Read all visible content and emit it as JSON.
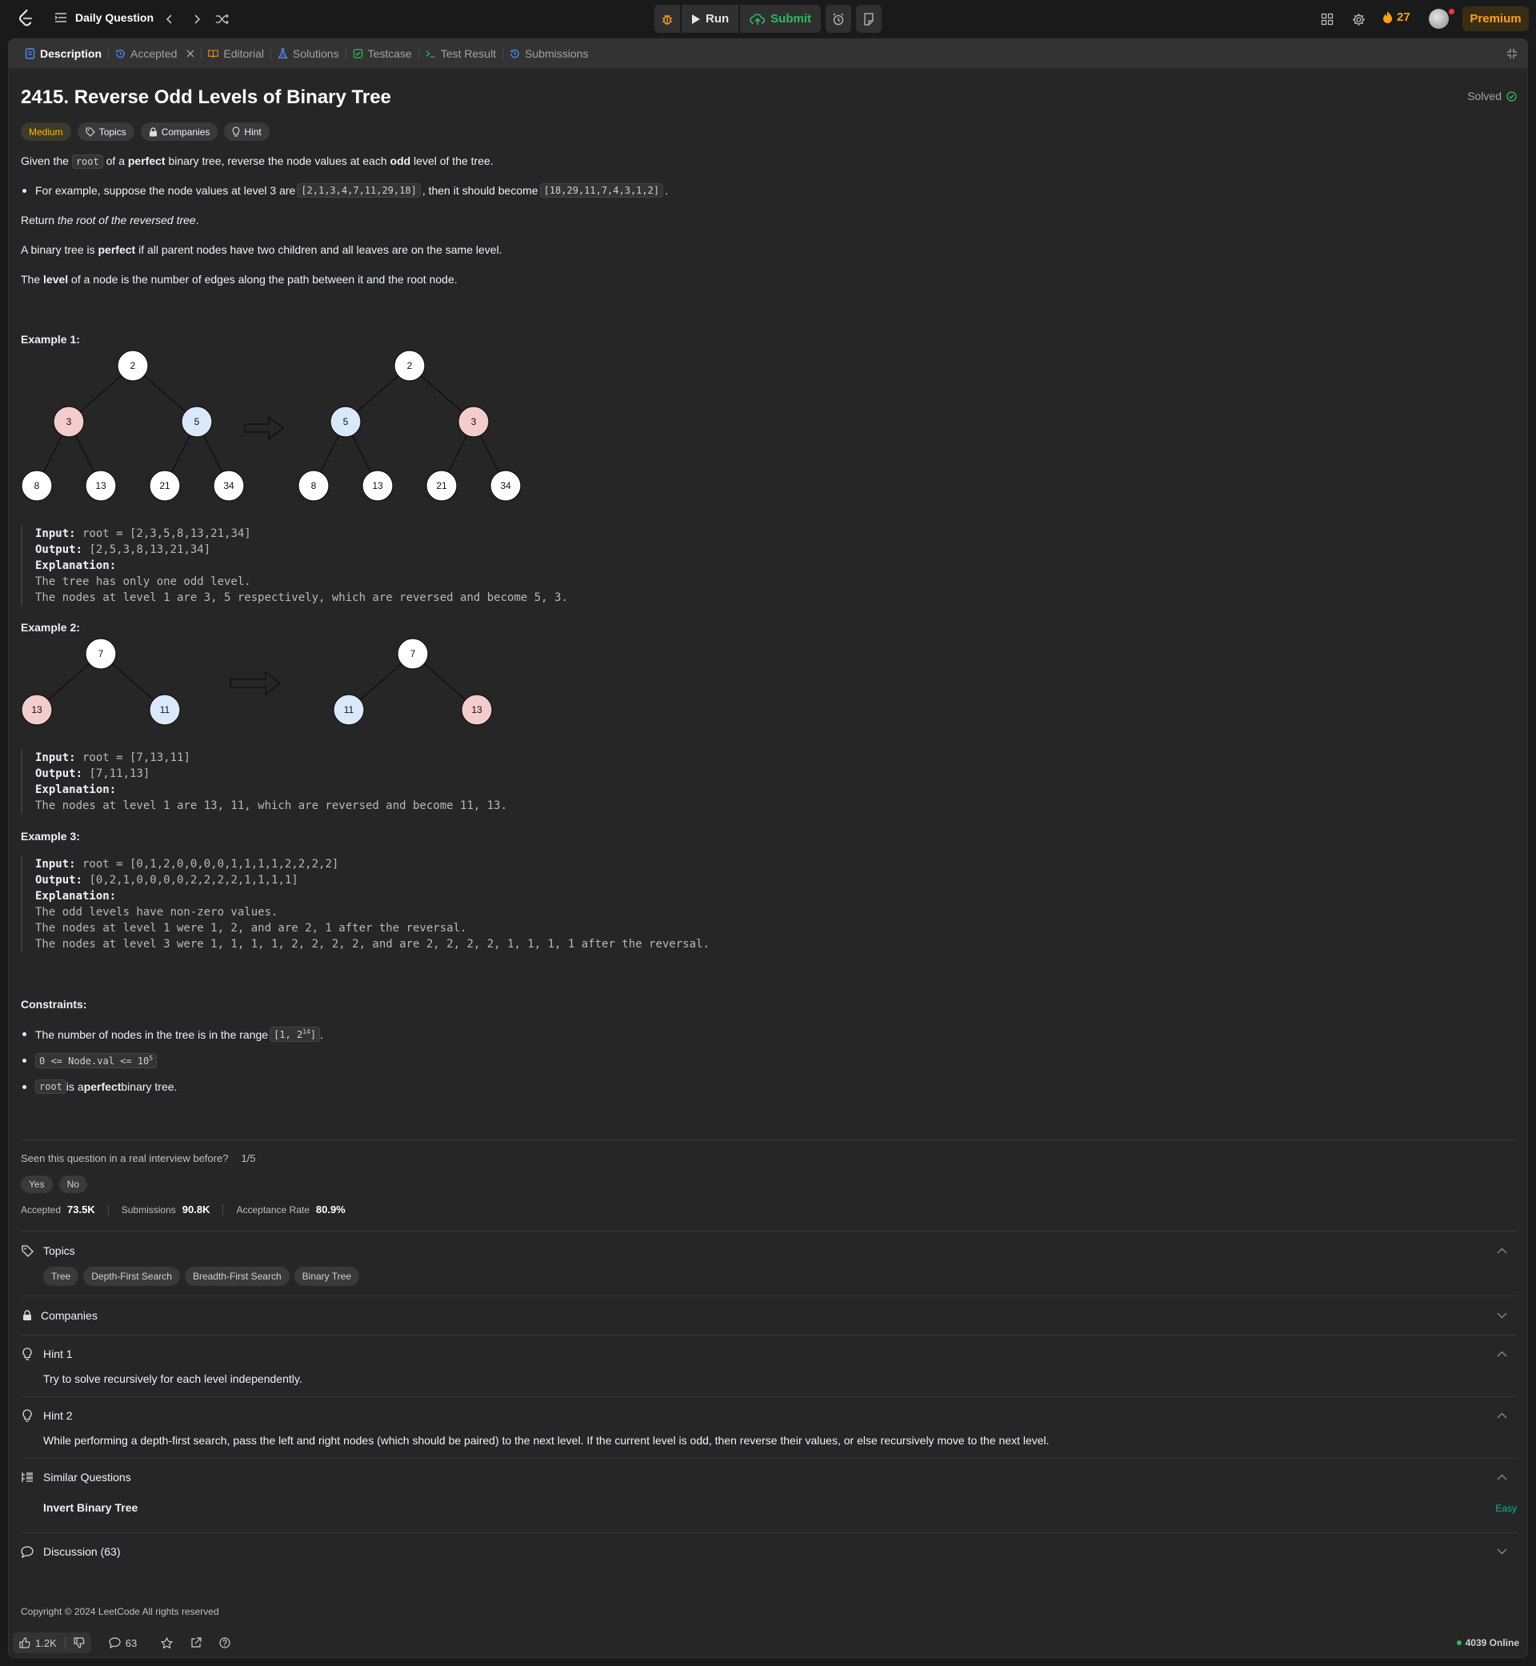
{
  "header": {
    "title": "Daily Question",
    "run_label": "Run",
    "submit_label": "Submit",
    "streak": "27",
    "premium_label": "Premium"
  },
  "tabs": [
    {
      "label": "Description"
    },
    {
      "label": "Accepted"
    },
    {
      "label": "Editorial"
    },
    {
      "label": "Solutions"
    },
    {
      "label": "Testcase"
    },
    {
      "label": "Test Result"
    },
    {
      "label": "Submissions"
    }
  ],
  "problem": {
    "title": "2415. Reverse Odd Levels of Binary Tree",
    "solved_label": "Solved",
    "chips": {
      "difficulty": "Medium",
      "topics": "Topics",
      "companies": "Companies",
      "hint": "Hint"
    },
    "desc": {
      "p1a": "Given the ",
      "p1code": "root",
      "p1b": " of a ",
      "p1bold": "perfect",
      "p1c": " binary tree, reverse the node values at each ",
      "p1bold2": "odd",
      "p1d": " level of the tree.",
      "b1a": "For example, suppose the node values at level 3 are ",
      "b1code": "[2,1,3,4,7,11,29,18]",
      "b1b": ", then it should become ",
      "b1code2": "[18,29,11,7,4,3,1,2]",
      "b1c": ".",
      "p2a": "Return ",
      "p2i": "the root of the reversed tree",
      "p2b": ".",
      "p3a": "A binary tree is ",
      "p3bold": "perfect",
      "p3b": " if all parent nodes have two children and all leaves are on the same level.",
      "p4a": "The ",
      "p4bold": "level",
      "p4b": " of a node is the number of edges along the path between it and the root node."
    },
    "example1": {
      "title": "Example 1:",
      "left": {
        "root": "2",
        "l1": [
          "3",
          "5"
        ],
        "l2": [
          "8",
          "13",
          "21",
          "34"
        ]
      },
      "right": {
        "root": "2",
        "l1": [
          "5",
          "3"
        ],
        "l2": [
          "8",
          "13",
          "21",
          "34"
        ]
      },
      "input_label": "Input:",
      "input": " root = [2,3,5,8,13,21,34]",
      "output_label": "Output:",
      "output": " [2,5,3,8,13,21,34]",
      "explanation_label": "Explanation:",
      "explanation": [
        "The tree has only one odd level.",
        "The nodes at level 1 are 3, 5 respectively, which are reversed and become 5, 3."
      ]
    },
    "example2": {
      "title": "Example 2:",
      "left": {
        "root": "7",
        "l1": [
          "13",
          "11"
        ]
      },
      "right": {
        "root": "7",
        "l1": [
          "11",
          "13"
        ]
      },
      "input_label": "Input:",
      "input": " root = [7,13,11]",
      "output_label": "Output:",
      "output": " [7,11,13]",
      "explanation_label": "Explanation:",
      "explanation": [
        "The nodes at level 1 are 13, 11, which are reversed and become 11, 13."
      ]
    },
    "example3": {
      "title": "Example 3:",
      "input_label": "Input:",
      "input": " root = [0,1,2,0,0,0,0,1,1,1,1,2,2,2,2]",
      "output_label": "Output:",
      "output": " [0,2,1,0,0,0,0,2,2,2,2,1,1,1,1]",
      "explanation_label": "Explanation:",
      "explanation": [
        "The odd levels have non-zero values.",
        "The nodes at level 1 were 1, 2, and are 2, 1 after the reversal.",
        "The nodes at level 3 were 1, 1, 1, 1, 2, 2, 2, 2, and are 2, 2, 2, 2, 1, 1, 1, 1 after the reversal."
      ]
    },
    "constraints": {
      "title": "Constraints:",
      "c1a": "The number of nodes in the tree is in the range ",
      "c1code": "[1, 2",
      "c1sup": "14",
      "c1code_end": "]",
      "c1b": ".",
      "c2code": "0 <= Node.val <= 10",
      "c2sup": "5",
      "c3code": "root",
      "c3a": " is a ",
      "c3bold": "perfect",
      "c3b": " binary tree."
    }
  },
  "interview": {
    "question": "Seen this question in a real interview before?",
    "count": "1/5",
    "yes": "Yes",
    "no": "No"
  },
  "stats": {
    "accepted_label": "Accepted",
    "accepted": "73.5K",
    "submissions_label": "Submissions",
    "submissions": "90.8K",
    "rate_label": "Acceptance Rate",
    "rate": "80.9%"
  },
  "sections": {
    "topics": {
      "label": "Topics",
      "tags": [
        "Tree",
        "Depth-First Search",
        "Breadth-First Search",
        "Binary Tree"
      ]
    },
    "companies": {
      "label": "Companies"
    },
    "hint1": {
      "label": "Hint 1",
      "text": "Try to solve recursively for each level independently."
    },
    "hint2": {
      "label": "Hint 2",
      "text": "While performing a depth-first search, pass the left and right nodes (which should be paired) to the next level. If the current level is odd, then reverse their values, or else recursively move to the next level."
    },
    "similar": {
      "label": "Similar Questions",
      "item": "Invert Binary Tree",
      "difficulty": "Easy"
    },
    "discussion": {
      "label": "Discussion (63)"
    }
  },
  "footer": {
    "copyright": "Copyright © 2024 LeetCode All rights reserved"
  },
  "bottombar": {
    "likes": "1.2K",
    "comments": "63",
    "online": "4039 Online"
  },
  "colors": {
    "accent_orange": "#ffa116",
    "green": "#2cbb5d",
    "medium": "#ffb800",
    "easy": "#00b8a3",
    "node_red": "#f4cccc",
    "node_blue": "#dae8fc"
  }
}
